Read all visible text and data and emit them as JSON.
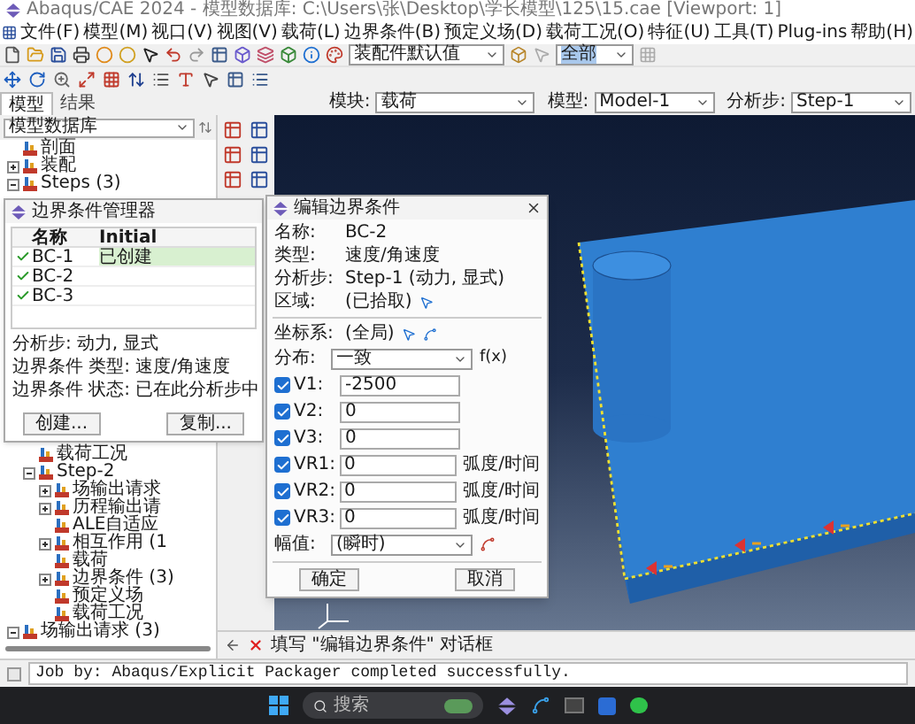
{
  "window": {
    "title": "Abaqus/CAE 2024 - 模型数据库: C:\\Users\\张\\Desktop\\学长模型\\125\\15.cae [Viewport: 1]"
  },
  "menu": [
    "文件(F)",
    "模型(M)",
    "视口(V)",
    "视图(V)",
    "载荷(L)",
    "边界条件(B)",
    "预定义场(D)",
    "载荷工况(O)",
    "特征(U)",
    "工具(T)",
    "Plug-ins",
    "帮助(H)"
  ],
  "toolbar": {
    "render_style": "装配件默认值",
    "selection": "全部"
  },
  "context_bar": {
    "tabs": [
      {
        "label": "模型",
        "selected": true
      },
      {
        "label": "结果",
        "selected": false
      }
    ],
    "module_label": "模块:",
    "module": "载荷",
    "model_label": "模型:",
    "model": "Model-1",
    "step_label": "分析步:",
    "step": "Step-1"
  },
  "model_tree": {
    "source": "模型数据库",
    "items": [
      {
        "label": "剖面"
      },
      {
        "label": "装配",
        "expanded": false
      },
      {
        "label": "Steps (3)",
        "expanded": true,
        "children": [
          {
            "label": "载荷工况"
          },
          {
            "label": "Step-2",
            "expanded": true,
            "children": [
              {
                "label": "场输出请求",
                "expanded": false
              },
              {
                "label": "历程输出请",
                "expanded": false
              },
              {
                "label": "ALE自适应"
              },
              {
                "label": "相互作用 (1",
                "expanded": false
              },
              {
                "label": "载荷"
              },
              {
                "label": "边界条件 (3)",
                "expanded": false
              },
              {
                "label": "预定义场"
              },
              {
                "label": "载荷工况"
              }
            ]
          }
        ]
      },
      {
        "label": "场输出请求 (3)",
        "expanded": true
      }
    ]
  },
  "bc_manager": {
    "title": "边界条件管理器",
    "columns": [
      "名称",
      "Initial"
    ],
    "rows": [
      {
        "name": "BC-1",
        "initial": "已创建",
        "active": true
      },
      {
        "name": "BC-2",
        "active": true
      },
      {
        "name": "BC-3",
        "active": true
      }
    ],
    "info": [
      {
        "label": "分析步:",
        "value": "动力, 显式"
      },
      {
        "label": "边界条件 类型:",
        "value": "速度/角速度"
      },
      {
        "label": "边界条件 状态:",
        "value": "已在此分析步中"
      }
    ],
    "buttons": [
      "创建...",
      "复制..."
    ]
  },
  "edit_dialog": {
    "title": "编辑边界条件",
    "info": [
      {
        "label": "名称:",
        "value": "BC-2"
      },
      {
        "label": "类型:",
        "value": "速度/角速度"
      },
      {
        "label": "分析步:",
        "value": "Step-1 (动力, 显式)"
      },
      {
        "label": "区域:",
        "value": "(已拾取)"
      }
    ],
    "csys": {
      "label": "坐标系:",
      "value": "(全局)"
    },
    "distribution": {
      "label": "分布:",
      "value": "一致",
      "fx": "f(x)"
    },
    "components": [
      {
        "label": "V1:",
        "value": "-2500",
        "checked": true
      },
      {
        "label": "V2:",
        "value": "0",
        "checked": true
      },
      {
        "label": "V3:",
        "value": "0",
        "checked": true
      },
      {
        "label": "VR1:",
        "value": "0",
        "unit": "弧度/时间",
        "checked": true
      },
      {
        "label": "VR2:",
        "value": "0",
        "unit": "弧度/时间",
        "checked": true
      },
      {
        "label": "VR3:",
        "value": "0",
        "unit": "弧度/时间",
        "checked": true
      }
    ],
    "amplitude": {
      "label": "幅值:",
      "value": "(瞬时)"
    },
    "buttons": [
      "确定",
      "取消"
    ]
  },
  "prompt": "填写 \"编辑边界条件\" 对话框",
  "message": "Job by: Abaqus/Explicit Packager completed successfully.",
  "taskbar": {
    "search_placeholder": "搜索"
  }
}
